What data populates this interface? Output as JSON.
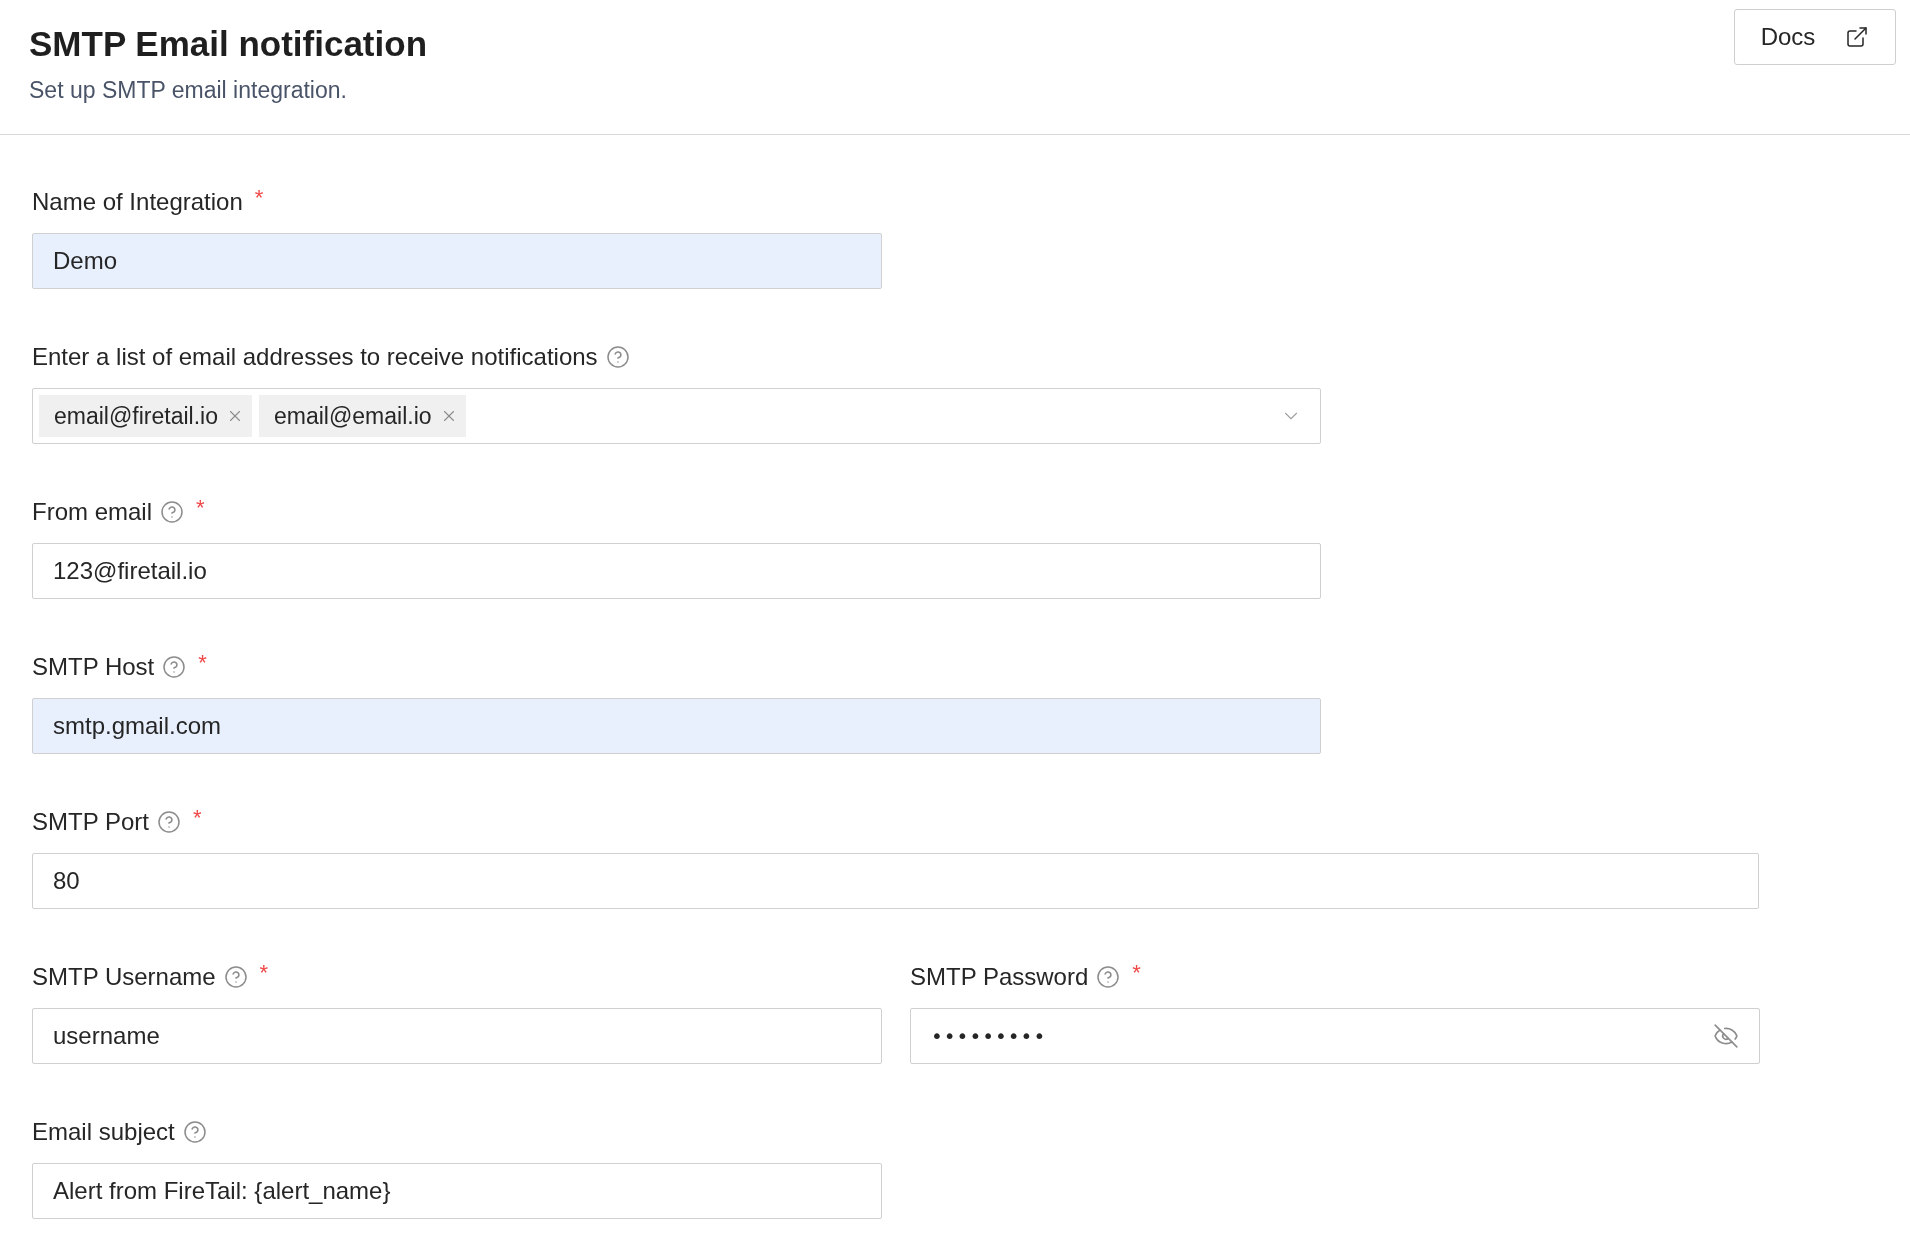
{
  "header": {
    "title": "SMTP Email notification",
    "subtitle": "Set up SMTP email integration.",
    "docs_button": "Docs"
  },
  "rows": [
    {
      "fields": [
        {
          "kind": "text",
          "label": "Name of Integration",
          "help": false,
          "required_mark": "*",
          "value": "Demo",
          "autofilled": true
        }
      ]
    },
    {
      "fields": [
        {
          "kind": "tags",
          "label": "Enter a list of email addresses to receive notifications",
          "help": true,
          "tags": [
            "email@firetail.io",
            "email@email.io"
          ]
        }
      ]
    },
    {
      "fields": [
        {
          "kind": "text",
          "label": "From email",
          "help": true,
          "required_mark": "*",
          "value": "123@firetail.io",
          "autofilled": false
        }
      ]
    },
    {
      "fields": [
        {
          "kind": "text",
          "label": "SMTP Host",
          "help": true,
          "required_mark": "*",
          "value": "smtp.gmail.com",
          "autofilled": true
        }
      ]
    },
    {
      "fields": [
        {
          "kind": "text",
          "label": "SMTP Port",
          "help": true,
          "required_mark": "*",
          "value": "80",
          "autofilled": false
        }
      ]
    },
    {
      "fields": [
        {
          "kind": "text",
          "label": "SMTP Username",
          "help": true,
          "required_mark": "*",
          "value": "username",
          "autofilled": false
        },
        {
          "kind": "password",
          "label": "SMTP Password",
          "help": true,
          "required_mark": "*",
          "value": "•••••••••",
          "autofilled": false
        }
      ]
    },
    {
      "fields": [
        {
          "kind": "text",
          "label": "Email subject",
          "help": true,
          "value": "Alert from FireTail: {alert_name}",
          "autofilled": false
        }
      ]
    }
  ]
}
